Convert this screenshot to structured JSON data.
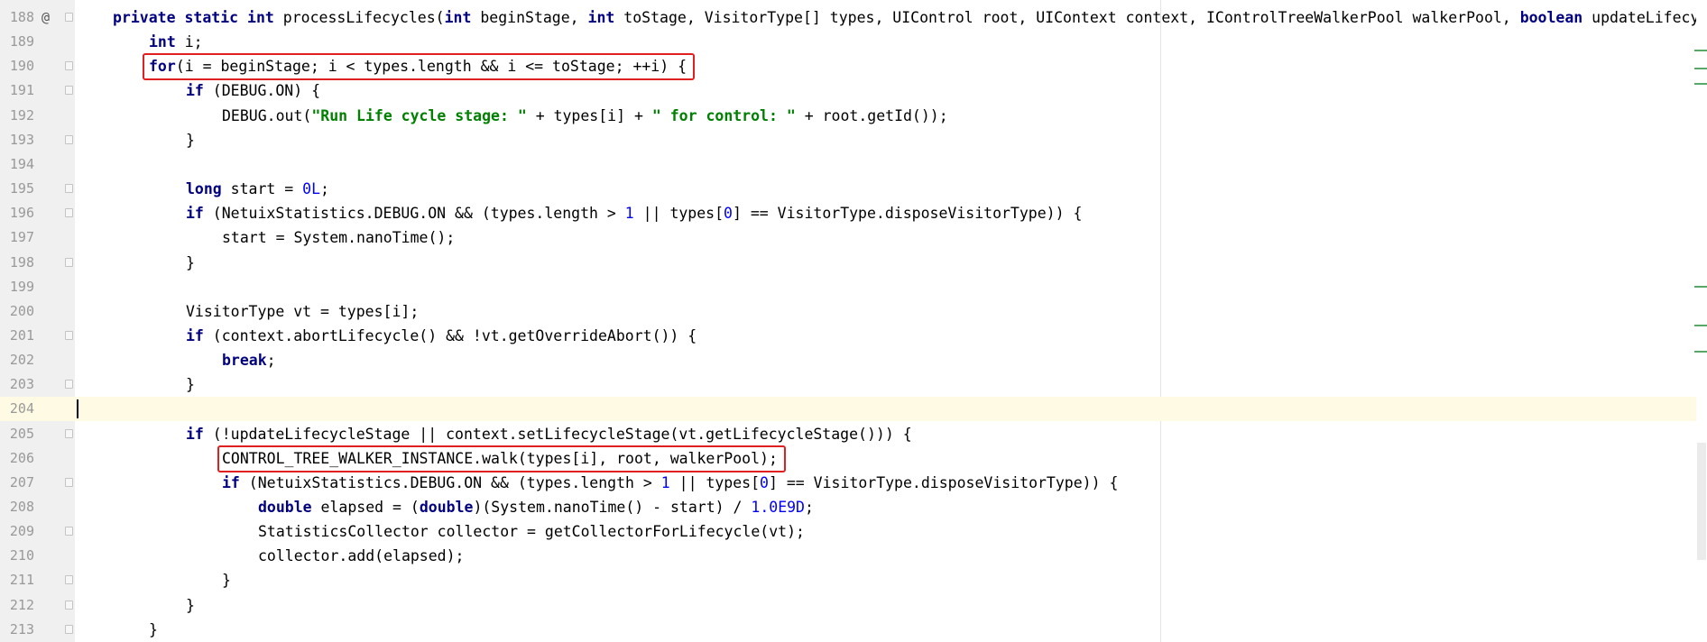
{
  "editor": {
    "lines": [
      {
        "num": "188",
        "annotation": "@",
        "tokens": [
          [
            "kw",
            "private"
          ],
          [
            "p",
            " "
          ],
          [
            "kw",
            "static"
          ],
          [
            "p",
            " "
          ],
          [
            "kw",
            "int"
          ],
          [
            "p",
            " processLifecycles("
          ],
          [
            "kw",
            "int"
          ],
          [
            "p",
            " beginStage, "
          ],
          [
            "kw",
            "int"
          ],
          [
            "p",
            " toStage, VisitorType[] types, UIControl root, UIContext context, IControlTreeWalkerPool walkerPool, "
          ],
          [
            "kw",
            "boolean"
          ],
          [
            "p",
            " updateLifecy"
          ]
        ]
      },
      {
        "num": "189",
        "tokens": [
          [
            "kw",
            "int"
          ],
          [
            "p",
            " i;"
          ]
        ]
      },
      {
        "num": "190",
        "tokens": [
          [
            "kw",
            "for"
          ],
          [
            "p",
            "(i = beginStage; i < types.length && i <= toStage; ++i) {"
          ]
        ]
      },
      {
        "num": "191",
        "tokens": [
          [
            "kw",
            "if"
          ],
          [
            "p",
            " (DEBUG.ON) {"
          ]
        ]
      },
      {
        "num": "192",
        "tokens": [
          [
            "p",
            "DEBUG.out("
          ],
          [
            "str",
            "\"Run Life cycle stage: \""
          ],
          [
            "p",
            " + types[i] + "
          ],
          [
            "str",
            "\" for control: \""
          ],
          [
            "p",
            " + root.getId());"
          ]
        ]
      },
      {
        "num": "193",
        "tokens": [
          [
            "p",
            "}"
          ]
        ]
      },
      {
        "num": "194",
        "tokens": []
      },
      {
        "num": "195",
        "tokens": [
          [
            "kw",
            "long"
          ],
          [
            "p",
            " start = "
          ],
          [
            "num",
            "0L"
          ],
          [
            "p",
            ";"
          ]
        ]
      },
      {
        "num": "196",
        "tokens": [
          [
            "kw",
            "if"
          ],
          [
            "p",
            " (NetuixStatistics.DEBUG.ON && (types.length > "
          ],
          [
            "num",
            "1"
          ],
          [
            "p",
            " || types["
          ],
          [
            "num",
            "0"
          ],
          [
            "p",
            "] == VisitorType.disposeVisitorType)) {"
          ]
        ]
      },
      {
        "num": "197",
        "tokens": [
          [
            "p",
            "start = System.nanoTime();"
          ]
        ]
      },
      {
        "num": "198",
        "tokens": [
          [
            "p",
            "}"
          ]
        ]
      },
      {
        "num": "199",
        "tokens": []
      },
      {
        "num": "200",
        "tokens": [
          [
            "p",
            "VisitorType vt = types[i];"
          ]
        ]
      },
      {
        "num": "201",
        "tokens": [
          [
            "kw",
            "if"
          ],
          [
            "p",
            " (context.abortLifecycle() && !vt.getOverrideAbort()) {"
          ]
        ]
      },
      {
        "num": "202",
        "tokens": [
          [
            "kw",
            "break"
          ],
          [
            "p",
            ";"
          ]
        ]
      },
      {
        "num": "203",
        "tokens": [
          [
            "p",
            "}"
          ]
        ]
      },
      {
        "num": "204",
        "tokens": []
      },
      {
        "num": "205",
        "tokens": [
          [
            "kw",
            "if"
          ],
          [
            "p",
            " (!updateLifecycleStage || context.setLifecycleStage(vt.getLifecycleStage())) {"
          ]
        ]
      },
      {
        "num": "206",
        "tokens": [
          [
            "p",
            "CONTROL_TREE_WALKER_INSTANCE.walk(types[i], root, walkerPool);"
          ]
        ]
      },
      {
        "num": "207",
        "tokens": [
          [
            "kw",
            "if"
          ],
          [
            "p",
            " (NetuixStatistics.DEBUG.ON && (types.length > "
          ],
          [
            "num",
            "1"
          ],
          [
            "p",
            " || types["
          ],
          [
            "num",
            "0"
          ],
          [
            "p",
            "] == VisitorType.disposeVisitorType)) {"
          ]
        ]
      },
      {
        "num": "208",
        "tokens": [
          [
            "kw",
            "double"
          ],
          [
            "p",
            " elapsed = ("
          ],
          [
            "kw",
            "double"
          ],
          [
            "p",
            ")(System.nanoTime() - start) / "
          ],
          [
            "num",
            "1.0E9D"
          ],
          [
            "p",
            ";"
          ]
        ]
      },
      {
        "num": "209",
        "tokens": [
          [
            "p",
            "StatisticsCollector collector = getCollectorForLifecycle(vt);"
          ]
        ]
      },
      {
        "num": "210",
        "tokens": [
          [
            "p",
            "collector.add(elapsed);"
          ]
        ]
      },
      {
        "num": "211",
        "tokens": [
          [
            "p",
            "}"
          ]
        ]
      },
      {
        "num": "212",
        "tokens": [
          [
            "p",
            "}"
          ]
        ]
      },
      {
        "num": "213",
        "tokens": [
          [
            "p",
            "}"
          ]
        ]
      }
    ]
  },
  "colors": {
    "keyword": "#000080",
    "string": "#008000",
    "number": "#0000ff",
    "highlight_box": "#e02020",
    "current_line": "#fffae3"
  }
}
